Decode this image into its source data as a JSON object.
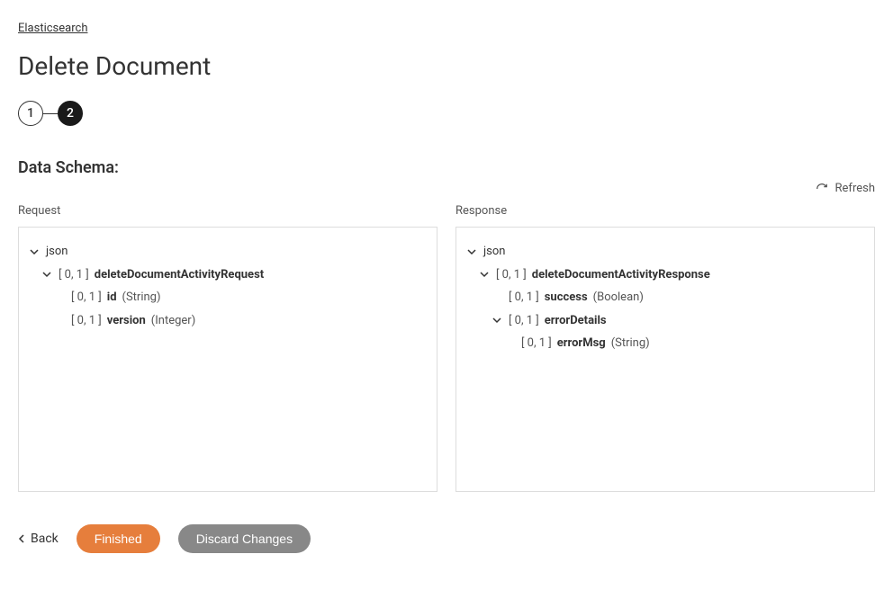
{
  "breadcrumb": "Elasticsearch",
  "title": "Delete Document",
  "steps": {
    "one": "1",
    "two": "2"
  },
  "sectionTitle": "Data Schema:",
  "refresh": "Refresh",
  "request": {
    "label": "Request",
    "root": "json",
    "main": {
      "card": "[ 0, 1 ]",
      "name": "deleteDocumentActivityRequest"
    },
    "id": {
      "card": "[ 0, 1 ]",
      "name": "id",
      "type": "(String)"
    },
    "version": {
      "card": "[ 0, 1 ]",
      "name": "version",
      "type": "(Integer)"
    }
  },
  "response": {
    "label": "Response",
    "root": "json",
    "main": {
      "card": "[ 0, 1 ]",
      "name": "deleteDocumentActivityResponse"
    },
    "success": {
      "card": "[ 0, 1 ]",
      "name": "success",
      "type": "(Boolean)"
    },
    "errorDetails": {
      "card": "[ 0, 1 ]",
      "name": "errorDetails"
    },
    "errorMsg": {
      "card": "[ 0, 1 ]",
      "name": "errorMsg",
      "type": "(String)"
    }
  },
  "actions": {
    "back": "Back",
    "finished": "Finished",
    "discard": "Discard Changes"
  }
}
